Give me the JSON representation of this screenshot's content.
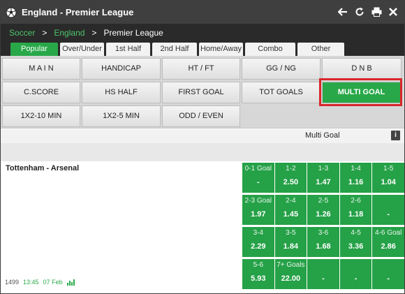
{
  "window": {
    "title": "England - Premier League"
  },
  "breadcrumb": {
    "sport": "Soccer",
    "country": "England",
    "league": "Premier League",
    "sep": ">"
  },
  "tabs": [
    "Popular",
    "Over/Under",
    "1st Half",
    "2nd Half",
    "Home/Away",
    "Combo",
    "Other"
  ],
  "markets": {
    "row1": [
      "M A I N",
      "HANDICAP",
      "HT / FT",
      "GG / NG",
      "D N B"
    ],
    "row2": [
      "C.SCORE",
      "HS HALF",
      "FIRST GOAL",
      "TOT GOALS",
      "MULTI GOAL"
    ],
    "row3": [
      "1X2-10 MIN",
      "1X2-5 MIN",
      "ODD / EVEN"
    ]
  },
  "section": {
    "title": "Multi Goal",
    "info_icon": "i"
  },
  "match": {
    "teams": "Tottenham - Arsenal",
    "code": "1499",
    "time": "13:45",
    "date": "07 Feb",
    "odds": [
      [
        {
          "label": "0-1 Goal",
          "value": "-"
        },
        {
          "label": "1-2",
          "value": "2.50"
        },
        {
          "label": "1-3",
          "value": "1.47"
        },
        {
          "label": "1-4",
          "value": "1.16"
        },
        {
          "label": "1-5",
          "value": "1.04"
        }
      ],
      [
        {
          "label": "2-3 Goal",
          "value": "1.97"
        },
        {
          "label": "2-4",
          "value": "1.45"
        },
        {
          "label": "2-5",
          "value": "1.26"
        },
        {
          "label": "2-6",
          "value": "1.18"
        },
        {
          "label": "",
          "value": "-"
        }
      ],
      [
        {
          "label": "3-4",
          "value": "2.29"
        },
        {
          "label": "3-5",
          "value": "1.84"
        },
        {
          "label": "3-6",
          "value": "1.68"
        },
        {
          "label": "4-5",
          "value": "3.36"
        },
        {
          "label": "4-6 Goal",
          "value": "2.86"
        }
      ],
      [
        {
          "label": "5-6",
          "value": "5.93"
        },
        {
          "label": "7+ Goals",
          "value": "22.00"
        },
        {
          "label": "",
          "value": "-"
        },
        {
          "label": "",
          "value": "-"
        },
        {
          "label": "",
          "value": "-"
        }
      ]
    ]
  },
  "colors": {
    "accent": "#29a849",
    "header": "#3f3f3f",
    "highlight_frame": "#d9262a"
  },
  "icons": [
    "soccer-ball-icon",
    "back-arrow-icon",
    "refresh-icon",
    "print-icon",
    "close-icon",
    "info-icon",
    "stats-icon"
  ]
}
